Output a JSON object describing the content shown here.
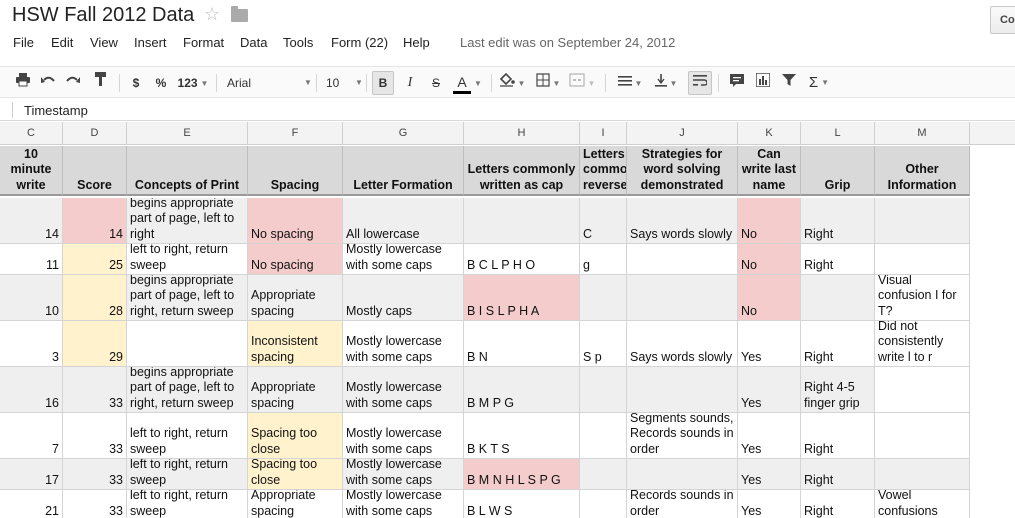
{
  "doc": {
    "title": "HSW Fall 2012 Data",
    "comments_label": "Comments"
  },
  "menu": [
    {
      "id": "file",
      "label": "File"
    },
    {
      "id": "edit",
      "label": "Edit"
    },
    {
      "id": "view",
      "label": "View"
    },
    {
      "id": "insert",
      "label": "Insert"
    },
    {
      "id": "format",
      "label": "Format"
    },
    {
      "id": "data",
      "label": "Data"
    },
    {
      "id": "tools",
      "label": "Tools"
    },
    {
      "id": "form",
      "label": "Form (22)"
    },
    {
      "id": "help",
      "label": "Help"
    }
  ],
  "last_edit": "Last edit was on September 24, 2012",
  "toolbar": {
    "currency_label": "$",
    "percent_label": "%",
    "number_format_label": "123",
    "font_name": "Arial",
    "font_size": "10",
    "bold_label": "B",
    "italic_label": "I",
    "strike_label": "S",
    "text_color_label": "A",
    "sum_label": "Σ"
  },
  "formula_bar": {
    "value": "Timestamp"
  },
  "columns": [
    "C",
    "D",
    "E",
    "F",
    "G",
    "H",
    "I",
    "J",
    "K",
    "L",
    "M"
  ],
  "header_row": [
    "10 minute write",
    "Score",
    "Concepts of Print",
    "Spacing",
    "Letter Formation",
    "Letters commonly written as cap",
    "Letters commo reverse",
    "Strategies for word solving demonstrated",
    "Can write last name",
    "Grip",
    "Other Information"
  ],
  "rows": [
    {
      "cells": [
        "14",
        "14",
        "begins appropriate part of page, left to right",
        "No spacing",
        "All lowercase",
        "",
        "C",
        "Says words slowly",
        "No",
        "Right",
        ""
      ],
      "fills": [
        "grey",
        "pink",
        "grey",
        "pink",
        "grey",
        "grey",
        "grey",
        "grey",
        "pink",
        "grey",
        "grey"
      ]
    },
    {
      "cells": [
        "11",
        "25",
        "left to right, return sweep",
        "No spacing",
        "Mostly lowercase with some caps",
        "B C L P H O",
        "g",
        "",
        "No",
        "Right",
        ""
      ],
      "fills": [
        "white",
        "yellow",
        "white",
        "pink",
        "white",
        "white",
        "white",
        "white",
        "pink",
        "white",
        "white"
      ]
    },
    {
      "cells": [
        "10",
        "28",
        "begins appropriate part of page, left to right, return sweep",
        "Appropriate spacing",
        "Mostly caps",
        "B I S L P H A",
        "",
        "",
        "No",
        "",
        "Visual confusion I for T?"
      ],
      "fills": [
        "grey",
        "yellow",
        "grey",
        "grey",
        "grey",
        "pink",
        "grey",
        "grey",
        "pink",
        "grey",
        "white"
      ]
    },
    {
      "cells": [
        "3",
        "29",
        "",
        "Inconsistent spacing",
        "Mostly lowercase with some caps",
        "B N",
        "S p",
        "Says words slowly",
        "Yes",
        "Right",
        "Did not consistently write l to r"
      ],
      "fills": [
        "white",
        "yellow",
        "white",
        "yellow",
        "white",
        "white",
        "white",
        "white",
        "white",
        "white",
        "white"
      ]
    },
    {
      "cells": [
        "16",
        "33",
        "begins appropriate part of page, left to right, return sweep",
        "Appropriate spacing",
        "Mostly lowercase with some caps",
        "B M P G",
        "",
        "",
        "Yes",
        "Right 4-5 finger grip",
        ""
      ],
      "fills": [
        "grey",
        "grey",
        "grey",
        "grey",
        "grey",
        "grey",
        "grey",
        "grey",
        "grey",
        "grey",
        "white"
      ]
    },
    {
      "cells": [
        "7",
        "33",
        "left to right, return sweep",
        "Spacing too close",
        "Mostly lowercase with some caps",
        "B K T S",
        "",
        "Segments sounds, Records sounds in order",
        "Yes",
        "Right",
        ""
      ],
      "fills": [
        "white",
        "white",
        "white",
        "yellow",
        "white",
        "white",
        "white",
        "white",
        "white",
        "white",
        "white"
      ]
    },
    {
      "cells": [
        "17",
        "33",
        "left to right, return sweep",
        "Spacing too close",
        "Mostly lowercase with some caps",
        "B M N H L S P G",
        "",
        "",
        "Yes",
        "Right",
        ""
      ],
      "fills": [
        "grey",
        "grey",
        "grey",
        "yellow",
        "grey",
        "pink",
        "grey",
        "grey",
        "grey",
        "grey",
        "grey"
      ]
    },
    {
      "cells": [
        "21",
        "33",
        "left to right, return sweep",
        "Appropriate spacing",
        "Mostly lowercase with some caps",
        "B L W S",
        "",
        "Records sounds in order",
        "Yes",
        "Right",
        "Vowel confusions"
      ],
      "fills": [
        "white",
        "white",
        "white",
        "white",
        "white",
        "white",
        "white",
        "white",
        "white",
        "white",
        "white"
      ]
    }
  ]
}
